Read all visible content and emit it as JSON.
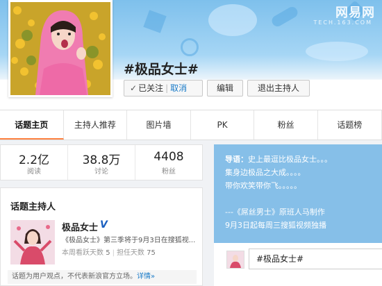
{
  "watermark": {
    "text": "网易网",
    "sub": "TECH.163.COM"
  },
  "profile": {
    "photo_alt": "话题头像"
  },
  "topic": {
    "title": "#极品女士#",
    "follow_check": "✓",
    "follow_label": "已关注",
    "follow_separator": "|",
    "unfollow_label": "取消",
    "edit_label": "编辑",
    "quit_host_label": "退出主持人"
  },
  "tabs": [
    {
      "label": "话题主页"
    },
    {
      "label": "主持人推荐"
    },
    {
      "label": "图片墙"
    },
    {
      "label": "PK"
    },
    {
      "label": "粉丝"
    },
    {
      "label": "话题榜"
    }
  ],
  "stats": [
    {
      "value": "2.2亿",
      "label": "阅读"
    },
    {
      "value": "38.8万",
      "label": "讨论"
    },
    {
      "value": "4408",
      "label": "粉丝"
    }
  ],
  "host": {
    "heading": "话题主持人",
    "name": "极品女士",
    "verified_mark": "V",
    "desc": "《极品女士》第三季将于9月3日在搜狐视...",
    "active_days_label": "本周看跃天数",
    "active_days_value": "5",
    "host_days_label": "担任天数",
    "host_days_value": "75",
    "disclaimer": "话题为用户观点，不代表新浪官方立场。",
    "more_link": "详情»"
  },
  "intro": {
    "lead": "导语：",
    "lines": [
      "史上最逗比极品女士。。。",
      "集身边极品之大成。。。。",
      "带你欢笑带你飞。。。。。",
      "",
      "---《屌丝男士》原班人马制作",
      "9月3日起每周三搜狐视频独播"
    ]
  },
  "compose": {
    "value": "#极品女士#"
  },
  "colors": {
    "accent": "#ff8140",
    "link": "#1a7bc8",
    "intro_bg": "#86bfe8",
    "banner": "#7ec0ec"
  },
  "icons": {
    "verified": "verified-v-icon",
    "follow": "check-icon"
  }
}
